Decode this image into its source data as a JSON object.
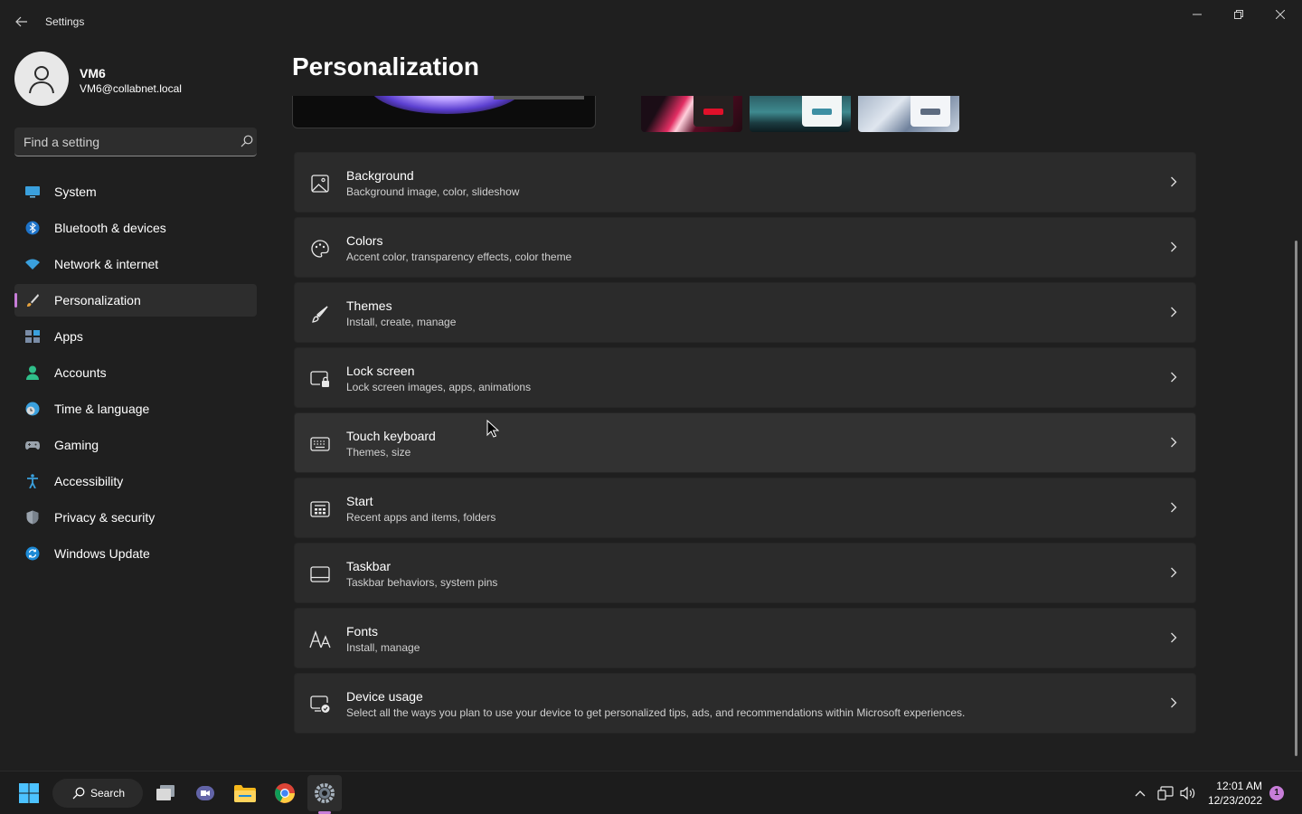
{
  "window": {
    "title": "Settings"
  },
  "profile": {
    "name": "VM6",
    "email": "VM6@collabnet.local"
  },
  "search": {
    "placeholder": "Find a setting"
  },
  "sidebar": {
    "active_index": 3,
    "items": [
      {
        "label": "System",
        "icon": "monitor-icon"
      },
      {
        "label": "Bluetooth & devices",
        "icon": "bluetooth-icon"
      },
      {
        "label": "Network & internet",
        "icon": "wifi-icon"
      },
      {
        "label": "Personalization",
        "icon": "brush-icon"
      },
      {
        "label": "Apps",
        "icon": "apps-icon"
      },
      {
        "label": "Accounts",
        "icon": "person-icon"
      },
      {
        "label": "Time & language",
        "icon": "globe-clock-icon"
      },
      {
        "label": "Gaming",
        "icon": "gamepad-icon"
      },
      {
        "label": "Accessibility",
        "icon": "accessibility-icon"
      },
      {
        "label": "Privacy & security",
        "icon": "shield-icon"
      },
      {
        "label": "Windows Update",
        "icon": "update-icon"
      }
    ]
  },
  "main": {
    "title": "Personalization",
    "items": [
      {
        "title": "Background",
        "subtitle": "Background image, color, slideshow",
        "icon": "image-icon"
      },
      {
        "title": "Colors",
        "subtitle": "Accent color, transparency effects, color theme",
        "icon": "palette-icon"
      },
      {
        "title": "Themes",
        "subtitle": "Install, create, manage",
        "icon": "brush-icon"
      },
      {
        "title": "Lock screen",
        "subtitle": "Lock screen images, apps, animations",
        "icon": "lock-screen-icon"
      },
      {
        "title": "Touch keyboard",
        "subtitle": "Themes, size",
        "icon": "keyboard-icon"
      },
      {
        "title": "Start",
        "subtitle": "Recent apps and items, folders",
        "icon": "start-icon"
      },
      {
        "title": "Taskbar",
        "subtitle": "Taskbar behaviors, system pins",
        "icon": "taskbar-icon"
      },
      {
        "title": "Fonts",
        "subtitle": "Install, manage",
        "icon": "fonts-icon"
      },
      {
        "title": "Device usage",
        "subtitle": "Select all the ways you plan to use your device to get personalized tips, ads, and recommendations within Microsoft experiences.",
        "icon": "device-usage-icon"
      }
    ]
  },
  "taskbar": {
    "search_label": "Search",
    "time": "12:01 AM",
    "date": "12/23/2022",
    "notification_count": "1"
  },
  "colors": {
    "accent": "#c77dd8",
    "background": "#1f1f1f",
    "card": "#2b2b2b"
  }
}
